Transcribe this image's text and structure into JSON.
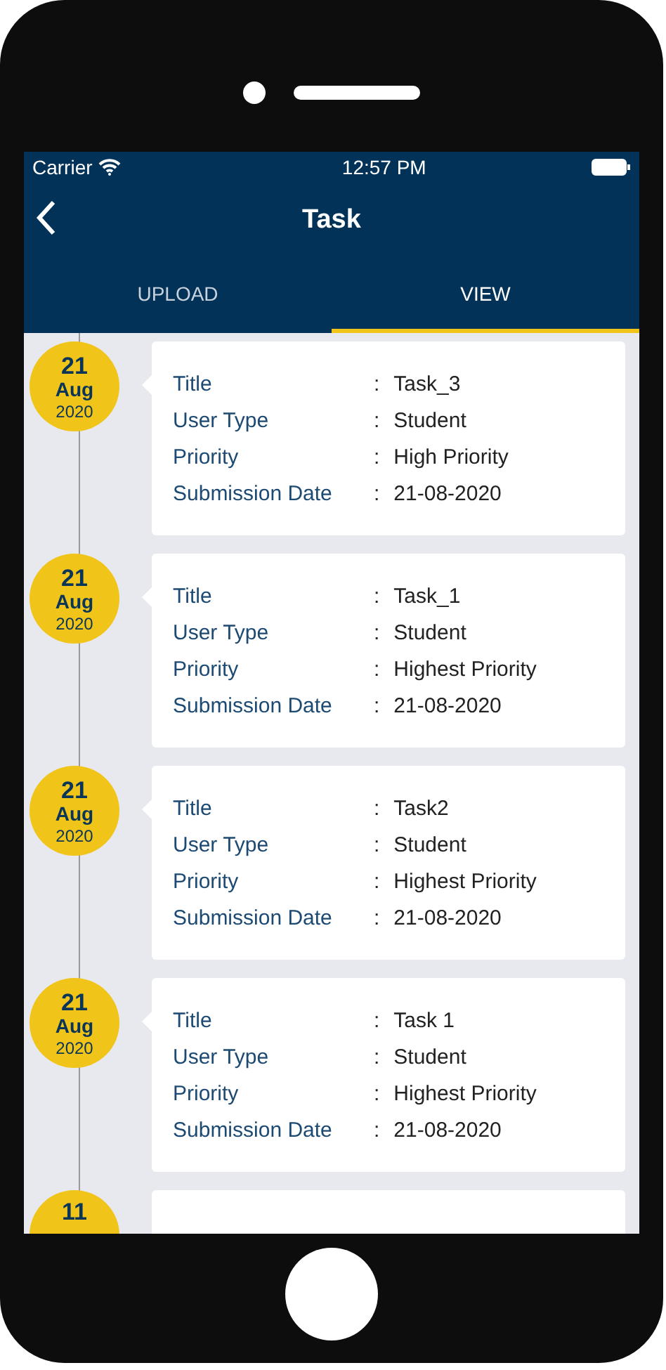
{
  "status_bar": {
    "carrier": "Carrier",
    "time": "12:57 PM"
  },
  "nav": {
    "title": "Task"
  },
  "tabs": [
    {
      "label": "UPLOAD",
      "selected": false
    },
    {
      "label": "VIEW",
      "selected": true
    }
  ],
  "tasks": [
    {
      "day": "21",
      "month": "Aug",
      "year": "2020",
      "fields": [
        {
          "label": "Title",
          "value": "Task_3"
        },
        {
          "label": "User Type",
          "value": "Student"
        },
        {
          "label": "Priority",
          "value": "High Priority"
        },
        {
          "label": "Submission Date",
          "value": "21-08-2020"
        }
      ]
    },
    {
      "day": "21",
      "month": "Aug",
      "year": "2020",
      "fields": [
        {
          "label": "Title",
          "value": "Task_1"
        },
        {
          "label": "User Type",
          "value": "Student"
        },
        {
          "label": "Priority",
          "value": "Highest Priority"
        },
        {
          "label": "Submission Date",
          "value": "21-08-2020"
        }
      ]
    },
    {
      "day": "21",
      "month": "Aug",
      "year": "2020",
      "fields": [
        {
          "label": "Title",
          "value": "Task2"
        },
        {
          "label": "User Type",
          "value": "Student"
        },
        {
          "label": "Priority",
          "value": "Highest Priority"
        },
        {
          "label": "Submission Date",
          "value": "21-08-2020"
        }
      ]
    },
    {
      "day": "21",
      "month": "Aug",
      "year": "2020",
      "fields": [
        {
          "label": "Title",
          "value": "Task 1"
        },
        {
          "label": "User Type",
          "value": "Student"
        },
        {
          "label": "Priority",
          "value": "Highest Priority"
        },
        {
          "label": "Submission Date",
          "value": "21-08-2020"
        }
      ]
    }
  ],
  "separator": ":",
  "partial_task": {
    "day": "11"
  }
}
